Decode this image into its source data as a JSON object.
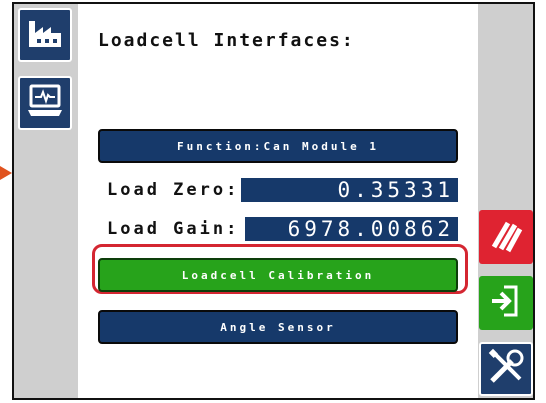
{
  "screen": {
    "title": "Loadcell Interfaces:"
  },
  "sidebar_left": {
    "items": [
      {
        "icon": "factory-icon"
      },
      {
        "icon": "computer-monitor-icon"
      }
    ]
  },
  "main": {
    "function_button_label": "Function:Can Module 1",
    "load_zero": {
      "label": "Load Zero:",
      "value": "0.35331"
    },
    "load_gain": {
      "label": "Load Gain:",
      "value": "6978.00862"
    },
    "calibration_button_label": "Loadcell Calibration",
    "angle_sensor_button_label": "Angle Sensor"
  },
  "sidebar_right": {
    "items": [
      {
        "icon": "hazard-stripes-icon",
        "color": "#df2331"
      },
      {
        "icon": "enter-arrow-icon",
        "color": "#27a31b"
      },
      {
        "icon": "tools-icon",
        "color": "#1f3e6c"
      }
    ]
  },
  "colors": {
    "navy": "#16396a",
    "green": "#27a31b",
    "red": "#df2331",
    "highlight": "#d42631",
    "panel_gray": "#cfcfcf"
  }
}
